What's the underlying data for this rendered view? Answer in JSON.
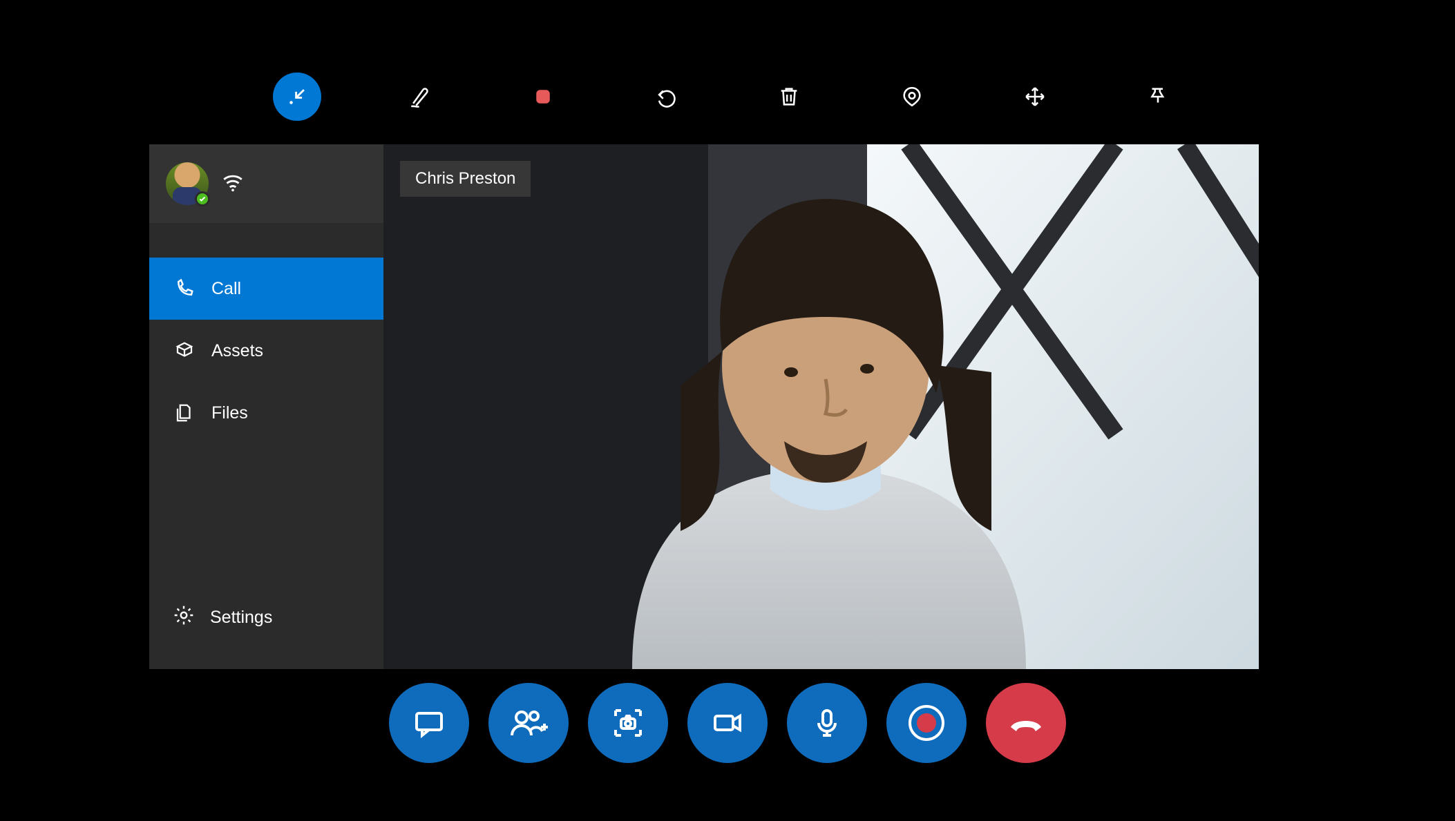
{
  "participant": {
    "name": "Chris Preston"
  },
  "sidebar": {
    "items": {
      "call": {
        "label": "Call",
        "selected": true
      },
      "assets": {
        "label": "Assets",
        "selected": false
      },
      "files": {
        "label": "Files",
        "selected": false
      },
      "settings": {
        "label": "Settings",
        "selected": false
      }
    }
  },
  "top_toolbar": {
    "minimize": "minimize",
    "ink": "ink",
    "stop": "stop-recording",
    "undo": "undo",
    "delete": "delete",
    "annotate": "annotate-target",
    "move": "move",
    "pin": "pin"
  },
  "call_bar": {
    "chat": "chat",
    "add_person": "add-participant",
    "snapshot": "snapshot",
    "video": "toggle-video",
    "mic": "toggle-mic",
    "record": "record",
    "hangup": "hang-up"
  },
  "colors": {
    "accent": "#0078d4",
    "call_button": "#0f6cbd",
    "hangup": "#d63b4a",
    "presence_online": "#4cbf1f"
  }
}
